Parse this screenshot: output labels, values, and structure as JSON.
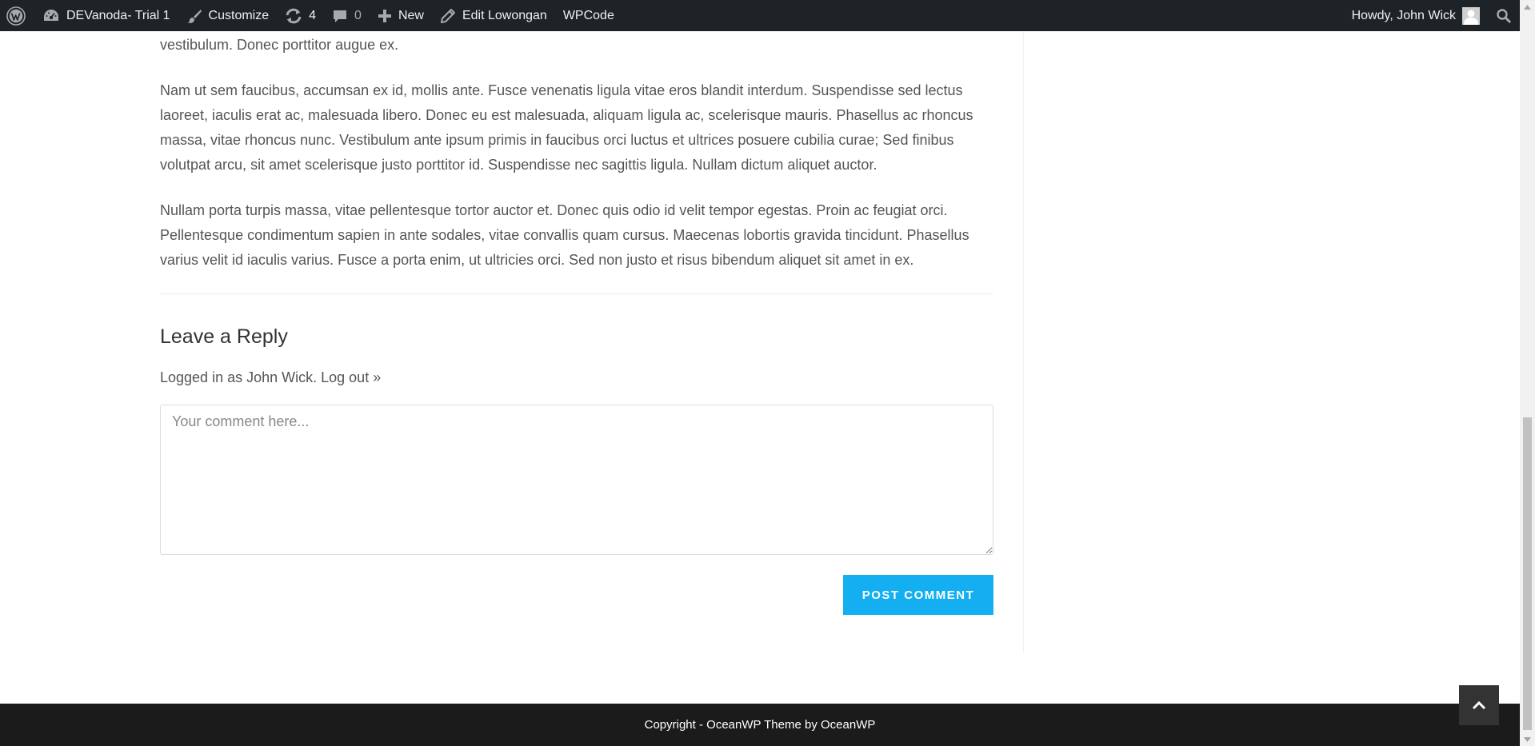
{
  "admin_bar": {
    "site_name": "DEVanoda- Trial 1",
    "customize": "Customize",
    "updates_count": "4",
    "comments_count": "0",
    "new": "New",
    "edit": "Edit Lowongan",
    "wpcode": "WPCode",
    "howdy": "Howdy, John Wick",
    "icons": [
      "wordpress-logo-icon",
      "dashboard-icon",
      "paintbrush-icon",
      "updates-icon",
      "comment-icon",
      "plus-icon",
      "pencil-icon",
      "avatar-icon",
      "search-icon"
    ]
  },
  "article": {
    "paragraph_1": "vestibulum. Donec porttitor augue ex.",
    "paragraph_2": "Nam ut sem faucibus, accumsan ex id, mollis ante. Fusce venenatis ligula vitae eros blandit interdum. Suspendisse sed lectus laoreet, iaculis erat ac, malesuada libero. Donec eu est malesuada, aliquam ligula ac, scelerisque mauris. Phasellus ac rhoncus massa, vitae rhoncus nunc. Vestibulum ante ipsum primis in faucibus orci luctus et ultrices posuere cubilia curae; Sed finibus volutpat arcu, sit amet scelerisque justo porttitor id. Suspendisse nec sagittis ligula. Nullam dictum aliquet auctor.",
    "paragraph_3": "Nullam porta turpis massa, vitae pellentesque tortor auctor et. Donec quis odio id velit tempor egestas. Proin ac feugiat orci. Pellentesque condimentum sapien in ante sodales, vitae convallis quam cursus. Maecenas lobortis gravida tincidunt. Phasellus varius velit id iaculis varius. Fusce a porta enim, ut ultricies orci. Sed non justo et risus bibendum aliquet sit amet in ex."
  },
  "reply": {
    "title": "Leave a Reply",
    "logged_in_prefix": "Logged in as John Wick.",
    "logout_link": "Log out »",
    "comment_placeholder": "Your comment here...",
    "comment_value": "",
    "submit_label": "POST COMMENT"
  },
  "footer": {
    "copyright": "Copyright - OceanWP Theme by OceanWP"
  },
  "colors": {
    "admin_bar_bg": "#1d2327",
    "accent": "#13aff0",
    "footer_bg": "#1b1b1b",
    "body_text": "#555555"
  }
}
